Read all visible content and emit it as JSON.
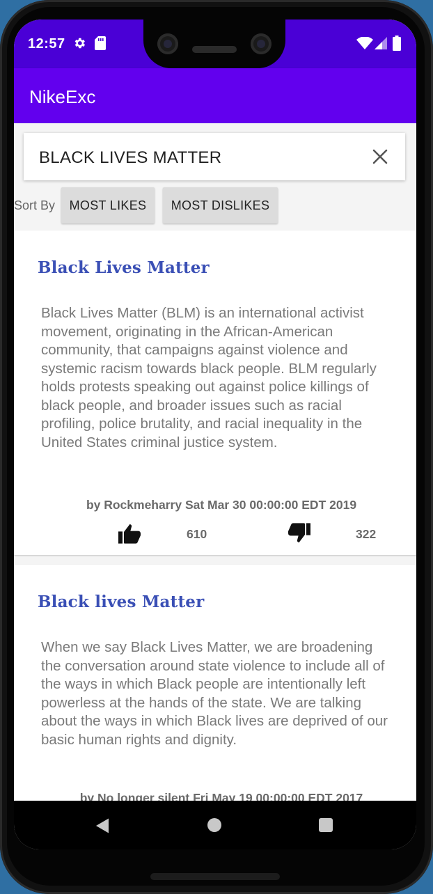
{
  "status": {
    "time": "12:57"
  },
  "appbar": {
    "title": "NikeExc"
  },
  "search": {
    "value": "BLACK LIVES MATTER"
  },
  "sort": {
    "label": "Sort By",
    "most_likes": "MOST LIKES",
    "most_dislikes": "MOST DISLIKES"
  },
  "posts": [
    {
      "title": "Black Lives Matter",
      "body": "Black Lives Matter (BLM) is an international activist movement, originating in the African-American community, that campaigns against violence and systemic racism towards black people. BLM regularly holds protests speaking out against police killings of black people, and broader issues such as racial profiling, police brutality, and racial inequality in the United States criminal justice system.",
      "author_line": "by Rockmeharry Sat Mar 30 00:00:00 EDT 2019",
      "likes": "610",
      "dislikes": "322"
    },
    {
      "title": "Black lives Matter",
      "body": "When we say Black Lives Matter, we are broadening the conversation around state violence to include all of the ways in which Black people are intentionally left powerless at the hands of the state. We are talking about the ways in which Black lives are deprived of our basic human rights and dignity.",
      "author_line": "by No longer silent Fri May 19 00:00:00 EDT 2017"
    }
  ],
  "icons": {
    "settings": "gear-icon",
    "sd_card": "sd-card-icon",
    "wifi": "wifi-icon",
    "signal": "signal-icon",
    "battery": "battery-icon",
    "clear": "close-icon",
    "like": "thumbs-up-icon",
    "dislike": "thumbs-down-icon",
    "back": "back-icon",
    "home": "home-icon",
    "recents": "recents-icon"
  },
  "colors": {
    "status_bar": "#4a00d6",
    "app_bar": "#6200ee",
    "post_title": "#3a4fb5",
    "sort_button": "#dcdcdc"
  }
}
